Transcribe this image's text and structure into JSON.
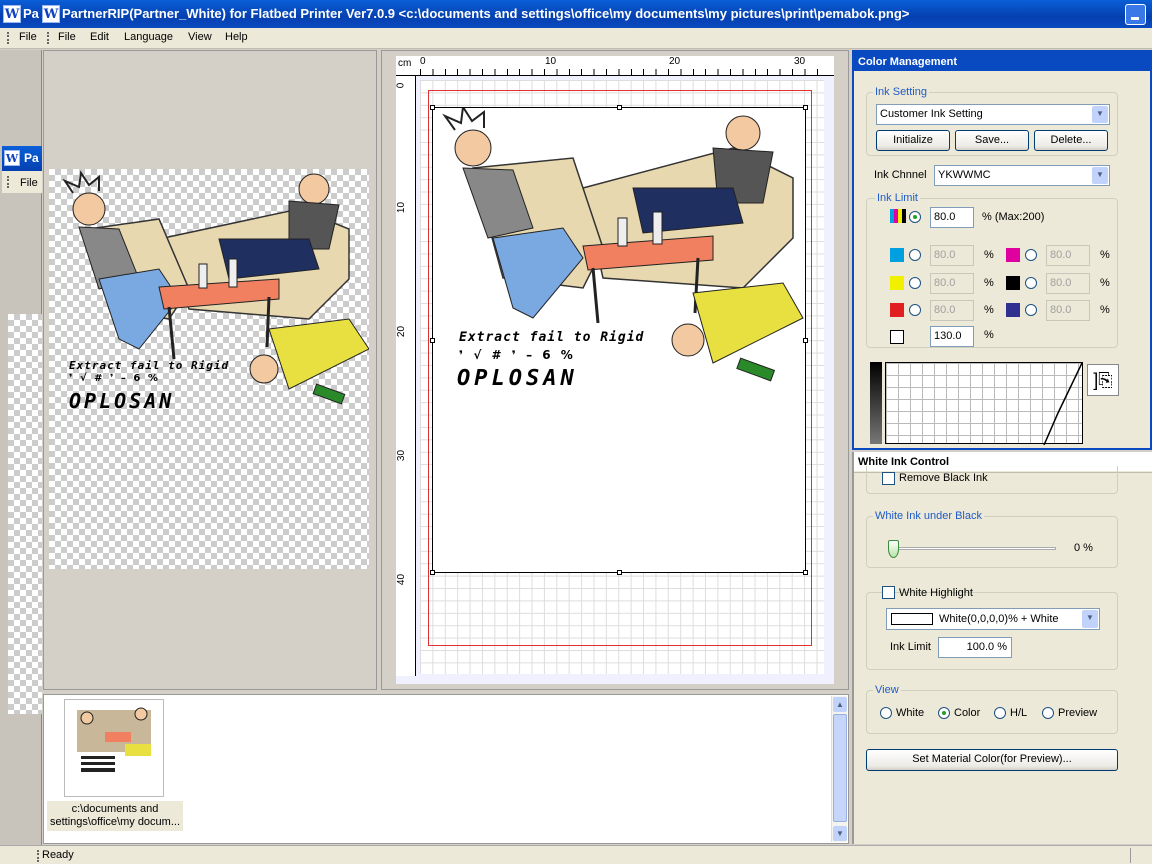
{
  "window": {
    "title": "PartnerRIP(Partner_White) for Flatbed Printer Ver7.0.9 <c:\\documents and settings\\office\\my documents\\my pictures\\print\\pemabok.png>"
  },
  "menu": {
    "file_left": "File",
    "items": [
      "File",
      "Edit",
      "Language",
      "View",
      "Help"
    ]
  },
  "child_window": {
    "title_fragment": "Pa",
    "menu_file": "File"
  },
  "artwork": {
    "line1": "Extract fail to Rigid",
    "symbols": "❜  √  #  ❜  –  6  %",
    "brand": "OPLOSAN"
  },
  "ruler": {
    "unit": "cm",
    "h_ticks": [
      "0",
      "10",
      "20",
      "30"
    ],
    "v_ticks": [
      "0",
      "10",
      "20",
      "30",
      "40"
    ]
  },
  "thumbnails": [
    {
      "caption": "c:\\documents and settings\\office\\my docum..."
    }
  ],
  "color_management": {
    "title": "Color Management",
    "ink_setting": {
      "label": "Ink Setting",
      "selected": "Customer Ink Setting",
      "buttons": [
        "Initialize",
        "Save...",
        "Delete..."
      ]
    },
    "ink_channel": {
      "label": "Ink Chnnel",
      "selected": "YKWWMC"
    },
    "ink_limit": {
      "label": "Ink Limit",
      "total": {
        "value": "80.0",
        "suffix": "% (Max:200)"
      },
      "channels": [
        {
          "color": "#00a0e0",
          "value": "80.0",
          "unit": "%"
        },
        {
          "color": "#e000a0",
          "value": "80.0",
          "unit": "%"
        },
        {
          "color": "#f0f000",
          "value": "80.0",
          "unit": "%"
        },
        {
          "color": "#000000",
          "value": "80.0",
          "unit": "%"
        },
        {
          "color": "#e02020",
          "value": "80.0",
          "unit": "%"
        },
        {
          "color": "#303090",
          "value": "80.0",
          "unit": "%"
        }
      ],
      "white": {
        "value": "130.0",
        "unit": "%"
      }
    }
  },
  "white_ink_control": {
    "title": "White Ink Control",
    "remove_black_ink": "Remove Black Ink",
    "under_black": {
      "label": "White Ink under Black",
      "value": "0 %",
      "level_percent": 0
    },
    "highlight": {
      "label": "White Highlight",
      "selected": "White(0,0,0,0)% + White",
      "ink_limit_label": "Ink Limit",
      "ink_limit_value": "100.0 %"
    },
    "view": {
      "label": "View",
      "options": [
        "White",
        "Color",
        "H/L",
        "Preview"
      ],
      "selected": "Color"
    },
    "set_material_button": "Set Material Color(for Preview)..."
  },
  "status_bar": {
    "text": "Ready"
  }
}
